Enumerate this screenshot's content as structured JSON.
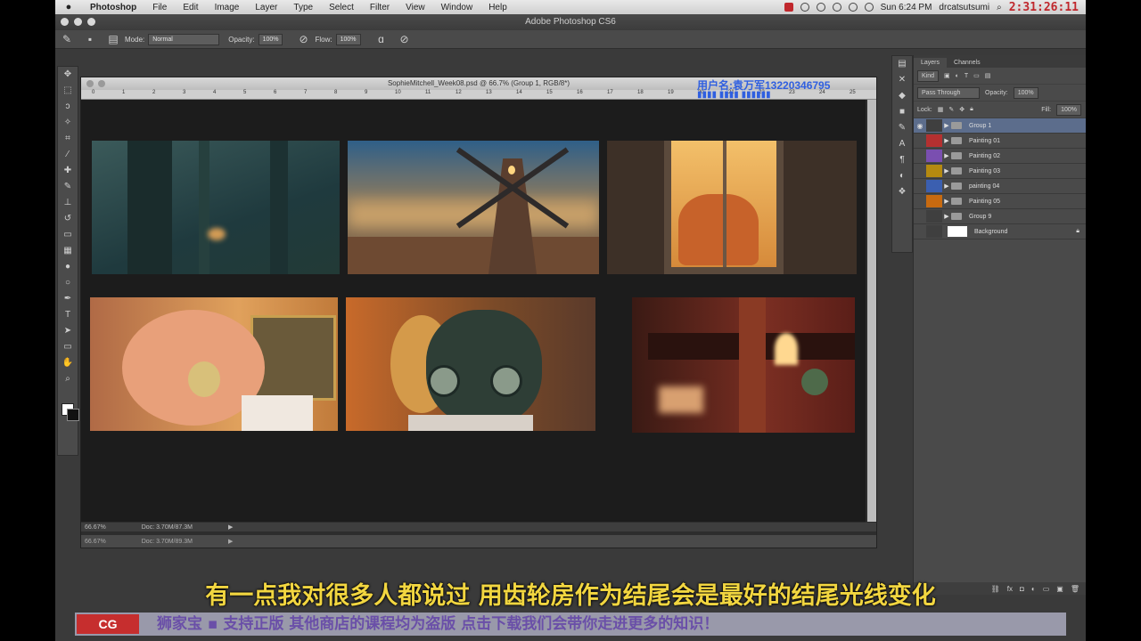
{
  "menubar": {
    "apple": "",
    "app": "Photoshop",
    "items": [
      "File",
      "Edit",
      "Image",
      "Layer",
      "Type",
      "Select",
      "Filter",
      "View",
      "Window",
      "Help"
    ],
    "clock": "Sun 6:24 PM",
    "user": "drcatsutsumi",
    "timer": "2:31:26:11"
  },
  "app": {
    "title": "Adobe Photoshop CS6"
  },
  "options": {
    "mode_label": "Mode:",
    "mode_value": "Normal",
    "opacity_label": "Opacity:",
    "opacity_value": "100%",
    "flow_label": "Flow:",
    "flow_value": "100%"
  },
  "document": {
    "title": "SophieMitchell_Week08.psd @ 66.7% (Group 1, RGB/8*)",
    "ruler": [
      "0",
      "1",
      "2",
      "3",
      "4",
      "5",
      "6",
      "7",
      "8",
      "9",
      "10",
      "11",
      "12",
      "13",
      "14",
      "15",
      "16",
      "17",
      "18",
      "19",
      "20",
      "21",
      "22",
      "23",
      "24",
      "25"
    ],
    "zoom": "66.67%",
    "doc_size": "Doc: 3.70M/87.3M",
    "zoom2": "66.67%",
    "doc_size2": "Doc: 3.70M/89.3M"
  },
  "watermark": {
    "user_line": "用户名:袁万军13220346795"
  },
  "layers_panel": {
    "tabs": [
      "Layers",
      "Channels"
    ],
    "kind": "Kind",
    "blend": "Pass Through",
    "opacity_label": "Opacity:",
    "opacity_value": "100%",
    "lock_label": "Lock:",
    "fill_label": "Fill:",
    "fill_value": "100%",
    "layers": [
      {
        "name": "Group 1",
        "color": "#3f3f3f"
      },
      {
        "name": "Painting 01",
        "color": "#b43030"
      },
      {
        "name": "Painting 02",
        "color": "#7a4fb0"
      },
      {
        "name": "Painting 03",
        "color": "#b58a10"
      },
      {
        "name": "painting 04",
        "color": "#3b5fb0"
      },
      {
        "name": "Painting 05",
        "color": "#c86a10"
      },
      {
        "name": "Group 9",
        "color": "#3f3f3f"
      },
      {
        "name": "Background",
        "color": "#3f3f3f"
      }
    ]
  },
  "subtitle": "有一点我对很多人都说过 用齿轮房作为结尾会是最好的结尾光线变化",
  "ticker": {
    "logo": "CG",
    "text": "狮家宝 ▪ 支持正版 其他商店的课程均为盗版 点击下载我们会带你走进更多的知识！"
  },
  "colors": {
    "accent": "#5c6d8c",
    "subtitle": "#f2d640",
    "watermark": "#2f5fe0"
  }
}
